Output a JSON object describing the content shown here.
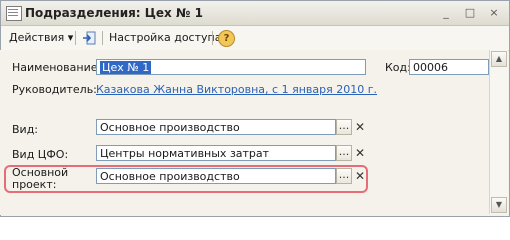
{
  "window": {
    "title": "Подразделения: Цех № 1",
    "controls": {
      "minimize": "_",
      "maximize": "□",
      "close": "×"
    }
  },
  "toolbar": {
    "actions_label": "Действия",
    "actions_arrow": "▾",
    "access_label": "Настройка доступа",
    "help_glyph": "?"
  },
  "form": {
    "name_label": "Наименование:",
    "name_value": "Цех № 1",
    "code_label": "Код:",
    "code_value": "00006",
    "manager_label": "Руководитель:",
    "manager_value": "Казакова Жанна Викторовна, с 1 января 2010 г.",
    "type_label": "Вид:",
    "type_value": "Основное производство",
    "cfo_label": "Вид ЦФО:",
    "cfo_value": "Центры нормативных затрат",
    "project_label_line1": "Основной",
    "project_label_line2": "проект:",
    "project_value": "Основное производство",
    "dots_glyph": "...",
    "clear_glyph": "✕"
  },
  "scrollbar": {
    "up_glyph": "▲",
    "down_glyph": "▼"
  },
  "colors": {
    "highlight": "#e66d77",
    "link": "#2a62b8",
    "selection": "#3168c5"
  }
}
